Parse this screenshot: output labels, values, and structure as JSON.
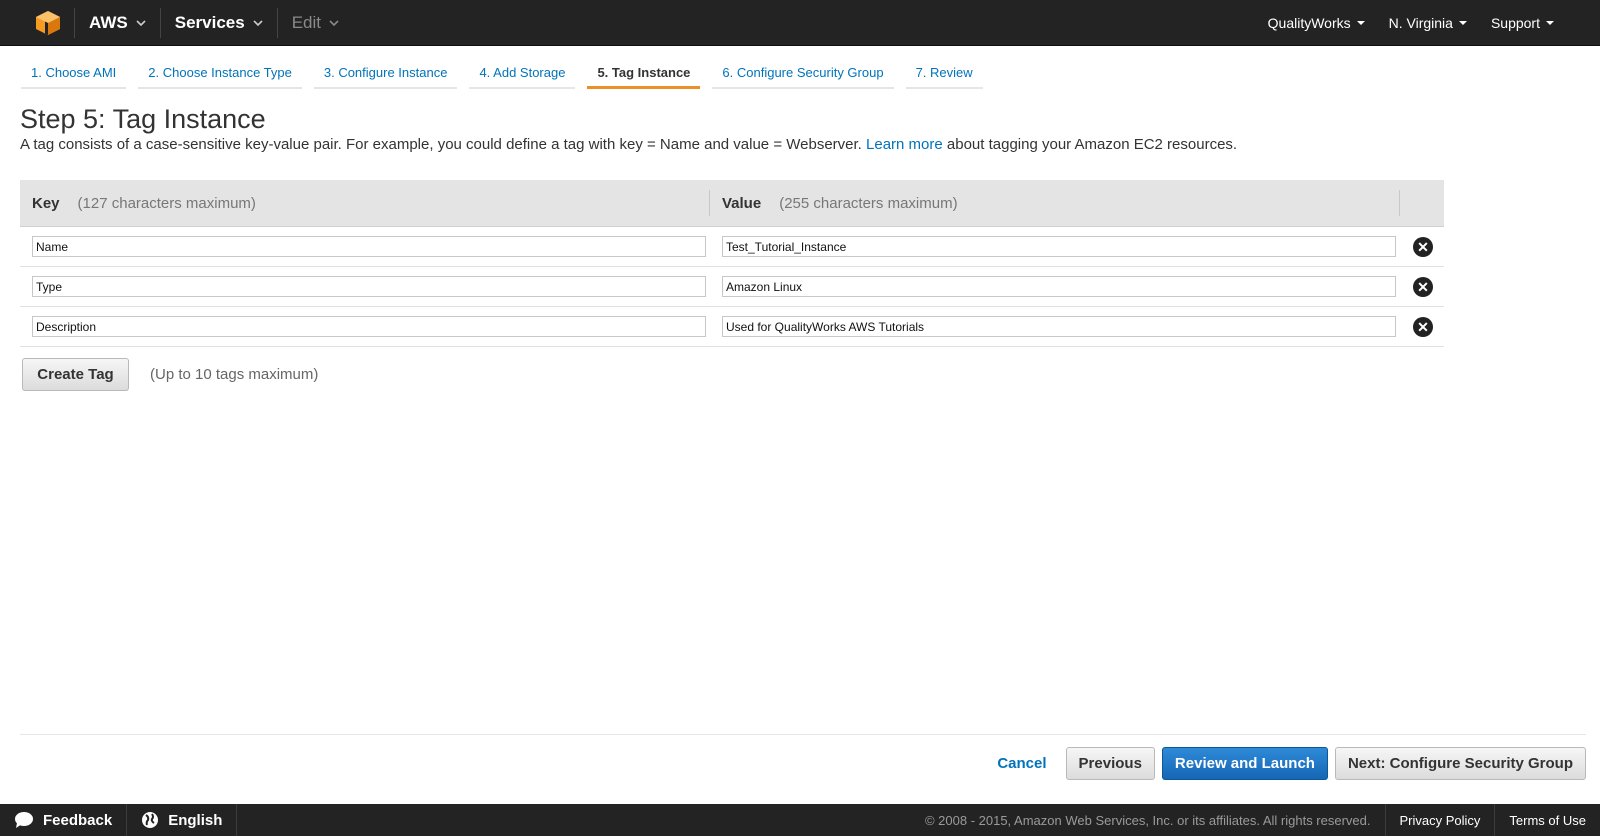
{
  "topnav": {
    "brand": "AWS",
    "services": "Services",
    "edit": "Edit",
    "account": "QualityWorks",
    "region": "N. Virginia",
    "support": "Support"
  },
  "wizard": {
    "tabs": [
      {
        "label": "1. Choose AMI"
      },
      {
        "label": "2. Choose Instance Type"
      },
      {
        "label": "3. Configure Instance"
      },
      {
        "label": "4. Add Storage"
      },
      {
        "label": "5. Tag Instance"
      },
      {
        "label": "6. Configure Security Group"
      },
      {
        "label": "7. Review"
      }
    ],
    "active_index": 4
  },
  "page": {
    "title": "Step 5: Tag Instance",
    "desc_before": "A tag consists of a case-sensitive key-value pair. For example, you could define a tag with key = Name and value = Webserver.",
    "learn_more": "Learn more",
    "desc_after": "about tagging your Amazon EC2 resources."
  },
  "table": {
    "key_header": "Key",
    "key_hint": "(127 characters maximum)",
    "value_header": "Value",
    "value_hint": "(255 characters maximum)",
    "rows": [
      {
        "key": "Name",
        "value": "Test_Tutorial_Instance"
      },
      {
        "key": "Type",
        "value": "Amazon Linux"
      },
      {
        "key": "Description",
        "value": "Used for QualityWorks AWS Tutorials"
      }
    ],
    "remove_glyph": "✕"
  },
  "create_tag": {
    "label": "Create Tag",
    "hint": "(Up to 10 tags maximum)"
  },
  "actions": {
    "cancel": "Cancel",
    "previous": "Previous",
    "review_launch": "Review and Launch",
    "next": "Next: Configure Security Group"
  },
  "footer": {
    "feedback": "Feedback",
    "language": "English",
    "copyright": "© 2008 - 2015, Amazon Web Services, Inc. or its affiliates. All rights reserved.",
    "privacy": "Privacy Policy",
    "terms": "Terms of Use"
  },
  "colors": {
    "nav_bg": "#232323",
    "link": "#0073bb",
    "active_tab_underline": "#ec8f27",
    "primary_button": "#1667b5"
  }
}
